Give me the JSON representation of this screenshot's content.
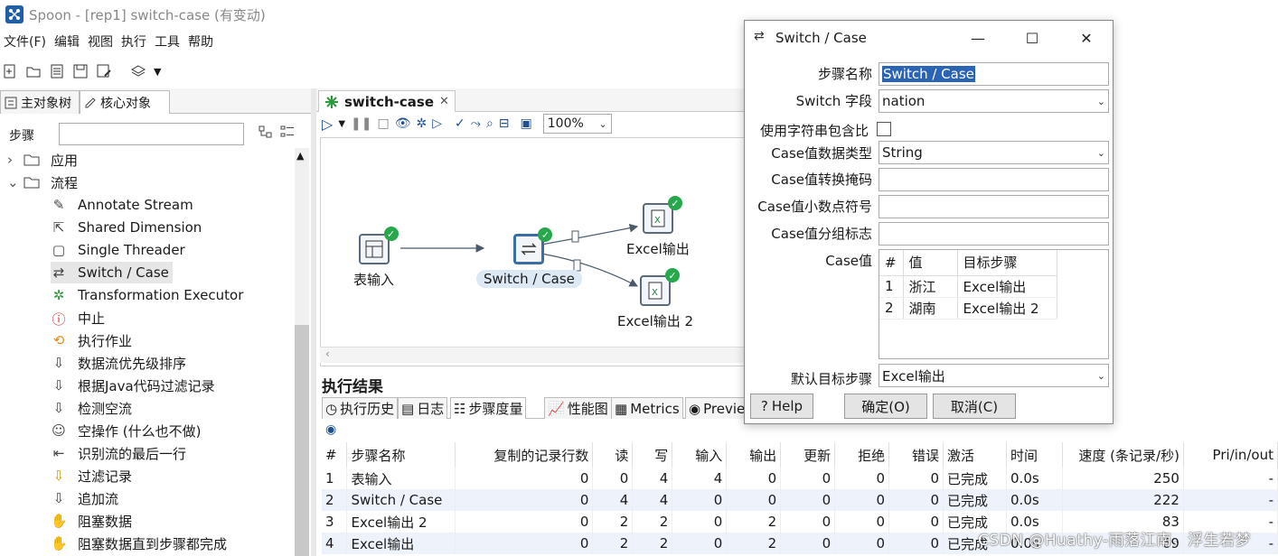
{
  "window": {
    "title": "Spoon - [rep1] switch-case (有变动)"
  },
  "menu": [
    "文件(F)",
    "编辑",
    "视图",
    "执行",
    "工具",
    "帮助"
  ],
  "left_panel": {
    "tabs": [
      "主对象树",
      "核心对象"
    ],
    "search_label": "步骤",
    "search_value": "",
    "tree": [
      {
        "label": "应用",
        "icon": "folder-icon",
        "expanded": false
      },
      {
        "label": "流程",
        "icon": "folder-icon",
        "expanded": true
      }
    ],
    "items": [
      "Annotate Stream",
      "Shared Dimension",
      "Single Threader",
      "Switch / Case",
      "Transformation Executor",
      "中止",
      "执行作业",
      "数据流优先级排序",
      "根据Java代码过滤记录",
      "检测空流",
      "空操作 (什么也不做)",
      "识别流的最后一行",
      "过滤记录",
      "追加流",
      "阻塞数据",
      "阻塞数据直到步骤都完成"
    ]
  },
  "canvas": {
    "tab_label": "switch-case",
    "zoom": "100%",
    "steps": [
      {
        "label": "表输入"
      },
      {
        "label": "Switch / Case"
      },
      {
        "label": "Excel输出"
      },
      {
        "label": "Excel输出 2"
      }
    ]
  },
  "results": {
    "title": "执行结果",
    "tabs": [
      "执行历史",
      "日志",
      "步骤度量",
      "性能图",
      "Metrics",
      "Previe"
    ],
    "columns": [
      "#",
      "步骤名称",
      "复制的记录行数",
      "读",
      "写",
      "输入",
      "输出",
      "更新",
      "拒绝",
      "错误",
      "激活",
      "时间",
      "速度 (条记录/秒)",
      "Pri/in/out"
    ],
    "rows": [
      [
        "1",
        "表输入",
        "0",
        "0",
        "4",
        "4",
        "0",
        "0",
        "0",
        "0",
        "已完成",
        "0.0s",
        "250",
        "-"
      ],
      [
        "2",
        "Switch / Case",
        "0",
        "4",
        "4",
        "0",
        "0",
        "0",
        "0",
        "0",
        "已完成",
        "0.0s",
        "222",
        "-"
      ],
      [
        "3",
        "Excel输出 2",
        "0",
        "2",
        "2",
        "0",
        "2",
        "0",
        "0",
        "0",
        "已完成",
        "0.0s",
        "83",
        "-"
      ],
      [
        "4",
        "Excel输出",
        "0",
        "2",
        "2",
        "0",
        "2",
        "0",
        "0",
        "0",
        "已完成",
        "0.0s",
        "69",
        "-"
      ]
    ]
  },
  "dialog": {
    "title": "Switch / Case",
    "fields": {
      "step_name_label": "步骤名称",
      "step_name_value": "Switch / Case",
      "switch_field_label": "Switch 字段",
      "switch_field_value": "nation",
      "use_contains_label": "使用字符串包含比",
      "use_contains_checked": false,
      "case_type_label": "Case值数据类型",
      "case_type_value": "String",
      "case_mask_label": "Case值转换掩码",
      "case_mask_value": "",
      "case_decimal_label": "Case值小数点符号",
      "case_decimal_value": "",
      "case_group_label": "Case值分组标志",
      "case_group_value": "",
      "case_values_label": "Case值",
      "default_target_label": "默认目标步骤",
      "default_target_value": "Excel输出"
    },
    "case_table": {
      "columns": [
        "#",
        "值",
        "目标步骤"
      ],
      "rows": [
        [
          "1",
          "浙江",
          "Excel输出"
        ],
        [
          "2",
          "湖南",
          "Excel输出 2"
        ]
      ]
    },
    "buttons": {
      "help": "Help",
      "ok": "确定(O)",
      "cancel": "取消(C)"
    }
  },
  "watermark": "CSDN @Huathy-雨落江南，浮生若梦",
  "colors": {
    "accent": "#2b63b5",
    "ok_badge": "#27a84a",
    "selection": "#e6e6e6"
  }
}
